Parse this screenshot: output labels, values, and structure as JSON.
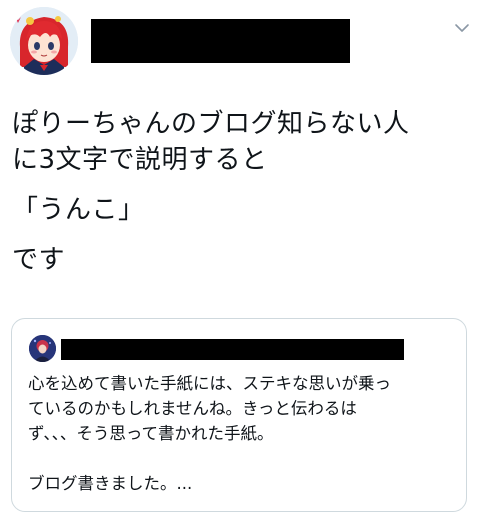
{
  "tweet": {
    "author_redacted": true,
    "text_lines": [
      "ぽりーちゃんのブログ知らない人",
      "に3文字で説明すると",
      "「うんこ」",
      "です"
    ],
    "menu_icon": "chevron-down-icon"
  },
  "quoted_tweet": {
    "author_redacted": true,
    "text_lines": [
      "心を込めて書いた手紙には、ステキな思いが乗っ",
      "ているのかもしれませんね。きっと伝わるは",
      "ず、、、そう思って書かれた手紙。",
      "",
      "ブログ書きました。..."
    ]
  },
  "colors": {
    "text": "#0f1419",
    "border": "#cfd9de",
    "redaction": "#000000",
    "muted_icon": "#8b98a5"
  }
}
